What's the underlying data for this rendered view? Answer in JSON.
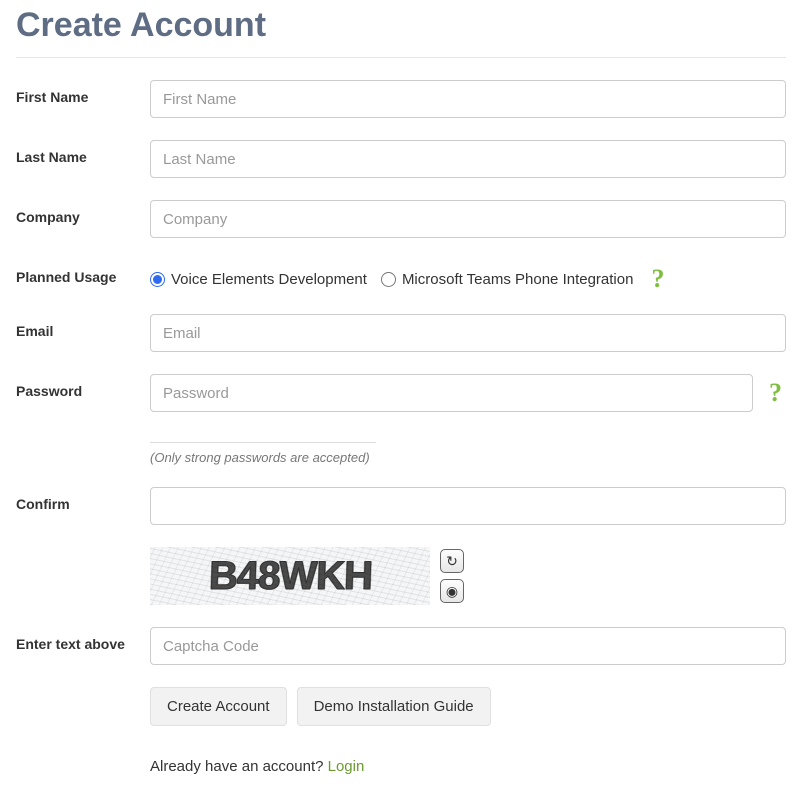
{
  "title": "Create Account",
  "labels": {
    "first_name": "First Name",
    "last_name": "Last Name",
    "company": "Company",
    "planned_usage": "Planned Usage",
    "email": "Email",
    "password": "Password",
    "confirm": "Confirm",
    "enter_text_above": "Enter text above"
  },
  "placeholders": {
    "first_name": "First Name",
    "last_name": "Last Name",
    "company": "Company",
    "email": "Email",
    "password": "Password",
    "captcha": "Captcha Code"
  },
  "usage_options": {
    "voice_elements": "Voice Elements Development",
    "ms_teams": "Microsoft Teams Phone Integration"
  },
  "password_hint": "(Only strong passwords are accepted)",
  "captcha_text": "B48WKH",
  "buttons": {
    "create": "Create Account",
    "guide": "Demo Installation Guide"
  },
  "login_prompt": {
    "text": "Already have an account? ",
    "link": "Login"
  },
  "icons": {
    "help": "?",
    "refresh": "↻",
    "audio": "◉"
  }
}
